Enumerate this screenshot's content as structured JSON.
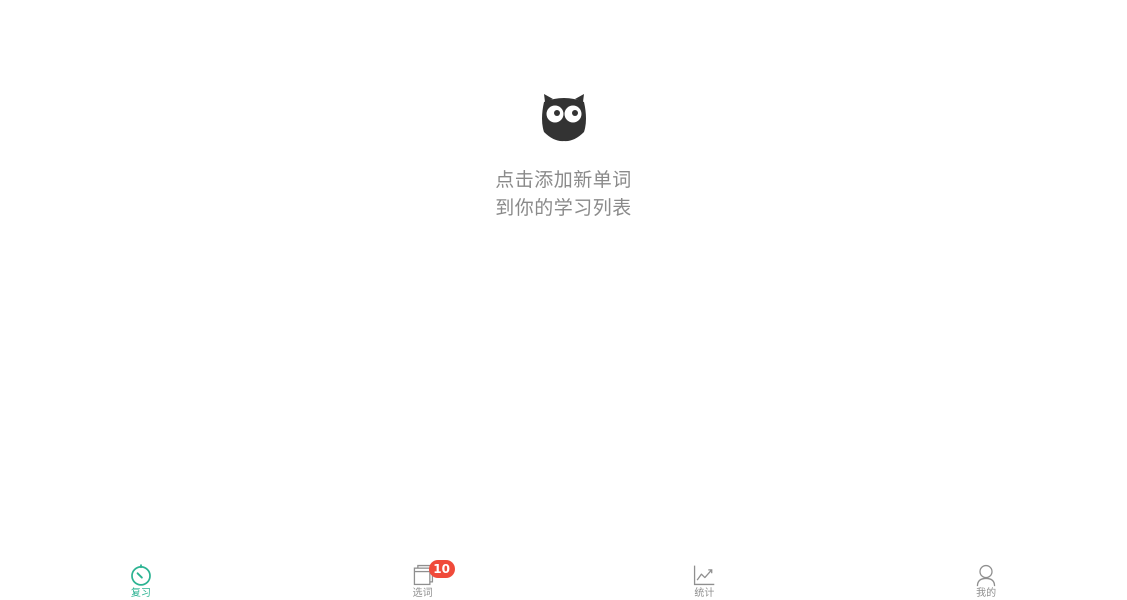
{
  "empty_state": {
    "icon": "owl-mascot-icon",
    "line1": "点击添加新单词",
    "line2": "到你的学习列表"
  },
  "tabbar": {
    "tabs": [
      {
        "label": "复习",
        "icon": "timer-icon",
        "active": true
      },
      {
        "label": "选词",
        "icon": "book-icon",
        "badge": "10",
        "active": false
      },
      {
        "label": "统计",
        "icon": "line-chart-icon",
        "active": false
      },
      {
        "label": "我的",
        "icon": "person-icon",
        "active": false
      }
    ]
  },
  "colors": {
    "accent": "#2bb392",
    "badge": "#f04a3a",
    "inactive": "#8f8f8f",
    "text_muted": "#8a8a8a",
    "owl": "#333333"
  }
}
